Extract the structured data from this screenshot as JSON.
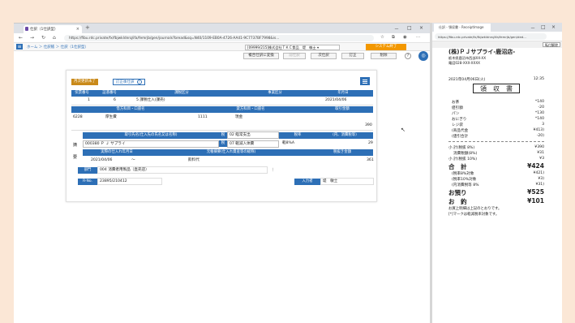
{
  "left_window": {
    "tab_title": "仕訳（1仕訳型）",
    "url": "https://fibu.rdc.private/fx/fbjwkldnrq/ifa/femrjb/gen/journals?bread&sq=N40/1109-EB0A-4726-AA41-9C7737BF7998&is...",
    "window_controls": [
      "－",
      "□",
      "×"
    ]
  },
  "breadcrumb": "ホーム ＞ 仕訳帳 ＞ 仕訳（1仕訳型）",
  "company_field": "[09999/215]株式会社ＴＫＣ食品　堤　敏士 ▾",
  "system_button": "システム終了",
  "toolbar": {
    "tax_change": "複合仕訳に変換",
    "prev": "前仕訳",
    "next": "次仕訳",
    "fix": "訂正",
    "delete": "削除",
    "help": "?"
  },
  "status": {
    "badge1": "月次更新未了",
    "badge2": "訂正後仕訳",
    "info": "i"
  },
  "labels": {
    "denpyo_no": "伝票番号",
    "shoko_no": "証憑番号",
    "kazei": "課税区分",
    "jigyo": "事業区分",
    "date": "年月日",
    "debit": "借方科目・口座名",
    "credit": "貸方科目・口座名",
    "amount": "取引金額",
    "partner": "取引先名(仕入先の氏名又は名称)",
    "tax_type": "税",
    "tax_rate": "税率",
    "tax_included": "(内、消費税等)",
    "actual_date": "実際の仕入れ年月日",
    "description": "元帳摘要(仕入れ資産等の総称)",
    "tax_amount": "税抜き金額",
    "dept": "部門",
    "rno": "R-No.",
    "input_person": "入力者"
  },
  "values": {
    "denpyo_no": "1",
    "shoko_no": "6",
    "kazei": "5 課税仕入(課売)",
    "date": "2021/04/06",
    "debit_code": "6228",
    "debit_name": "厚生費",
    "credit_code": "1111",
    "credit_name": "現金",
    "amount": "390",
    "partner": "000380 Ｐ Ｊ サプライ",
    "tax_1": "02 経常支出",
    "tax_2": "07 軽減入体費",
    "tax_rate": "軽8%A",
    "tax_included": "29",
    "actual_date": "2021/04/06",
    "tilde": "〜",
    "description": "飲料代",
    "tax_amount": "361",
    "dept": "004 消費者用製品（直売店）",
    "rno": "23895/210412",
    "input_person": "堤　敏士"
  },
  "right_window": {
    "tab_title": "仕訳 - 領収書 - ReceiptImage",
    "url": "https://fibu.rdc.private/fx/fbjwkldnrq/ifa/femrjb/gen/ded...",
    "save_button": "転付解除"
  },
  "receipt": {
    "store": "(株)ＰＪサプライ-鹿沼店-",
    "address": "栃木県鹿沼市西部XX-XX",
    "phone": "電話028-XXX-XXXX",
    "datetime": "2021年04月06日(火)",
    "time": "12:35",
    "title": "領　収　書",
    "items": [
      {
        "name": "お茶",
        "price": "*140"
      },
      {
        "name": "値引額",
        "price": "-20"
      },
      {
        "name": "パン",
        "price": "*130"
      },
      {
        "name": "おにぎり",
        "price": "*140"
      },
      {
        "name": "レジ袋",
        "price": "3"
      },
      {
        "name": "(商品代金",
        "price": "¥413)"
      },
      {
        "name": "(値引合計",
        "price": "-20)"
      }
    ],
    "sub1": {
      "name": "小 計(税抜 8%)",
      "price": "¥390"
    },
    "sub1b": {
      "name": "消費税額(8%)",
      "price": "¥31"
    },
    "sub2": {
      "name": "小 計(税抜 10%)",
      "price": "¥3"
    },
    "total": {
      "name": "合　計",
      "price": "¥424"
    },
    "t1": {
      "name": "(税率8%対象",
      "price": "¥421)"
    },
    "t2": {
      "name": "(税率10%対象",
      "price": "¥3)"
    },
    "t3": {
      "name": "(内消費税等 8%",
      "price": "¥31)"
    },
    "paid": {
      "name": "お預り",
      "price": "¥525"
    },
    "change": {
      "name": "お　釣",
      "price": "¥101"
    },
    "note1": "お買上明細は上記のとおりです。",
    "note2": "[*]マークは軽減税率対象です。"
  },
  "colors": {
    "accent": "#2d6fb6",
    "badge_orange": "#c98a1a",
    "badge_blue": "#2d6fb6",
    "system": "#f39800"
  }
}
